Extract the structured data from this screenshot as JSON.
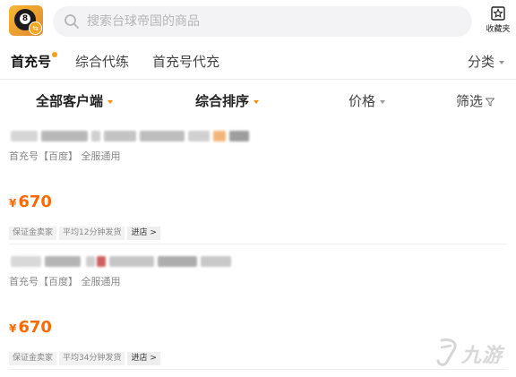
{
  "header": {
    "app_icon_number": "8",
    "app_icon_badge": "⇆",
    "search_placeholder": "搜索台球帝国的商品",
    "collect_label": "收藏夹"
  },
  "tabs": {
    "items": [
      {
        "label": "首充号",
        "active": true
      },
      {
        "label": "综合代练",
        "active": false
      },
      {
        "label": "首充号代充",
        "active": false
      }
    ],
    "category_label": "分类"
  },
  "filters": {
    "client": "全部客户端",
    "sort": "综合排序",
    "price": "价格",
    "filter": "筛选"
  },
  "listings": [
    {
      "subtitle": "首充号【百度】 全服通用",
      "currency": "¥",
      "price": "670",
      "tag_deposit": "保证金卖家",
      "tag_ship": "平均12分钟发货",
      "enter_label": "进店 >"
    },
    {
      "subtitle": "首充号【百度】 全服通用",
      "currency": "¥",
      "price": "670",
      "tag_deposit": "保证金卖家",
      "tag_ship": "平均34分钟发货",
      "enter_label": "进店 >"
    }
  ],
  "watermark": {
    "text": "九游",
    "icon": "stylized-j-logo"
  },
  "colors": {
    "accent": "#ff6a00",
    "tab_dot": "#ff9c1a",
    "search_bg": "#f3f3f5"
  }
}
